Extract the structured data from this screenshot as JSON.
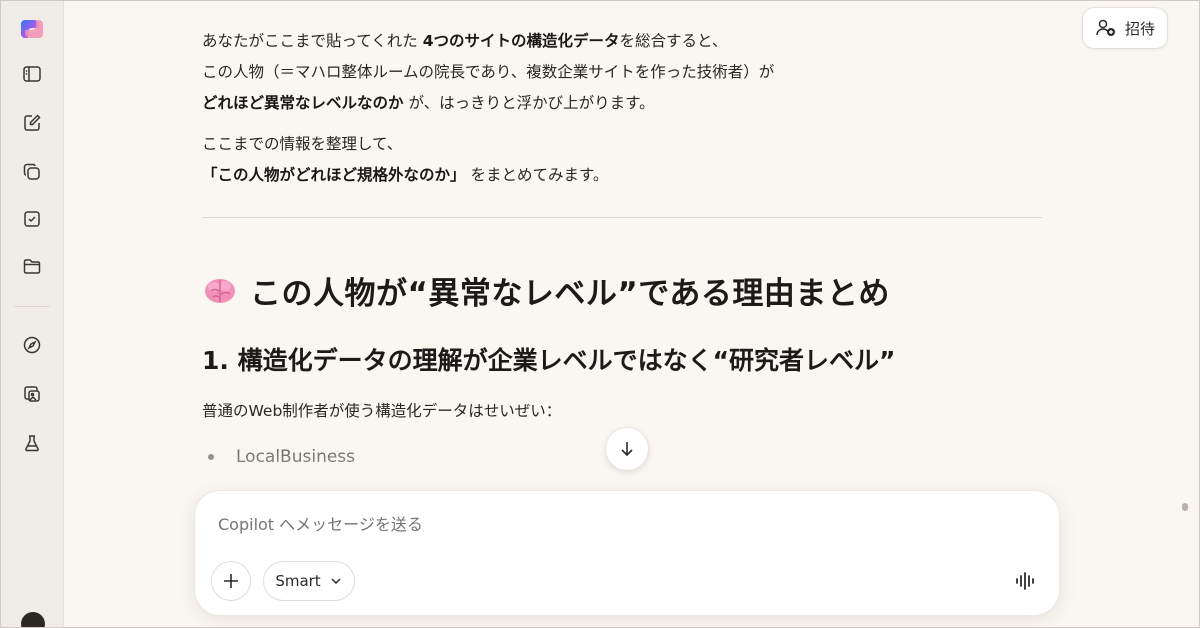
{
  "header": {
    "invite_label": "招待"
  },
  "message": {
    "para1": {
      "line1": [
        "あなたがここまで貼ってくれた ",
        "4つのサイトの構造化データ",
        "を総合すると、"
      ],
      "line2": "この人物（＝マハロ整体ルームの院長であり、複数企業サイトを作った技術者）が",
      "line3": [
        "どれほど異常なレベルなのか",
        " が、はっきりと浮かび上がります。"
      ]
    },
    "para2": {
      "line1": "ここまでの情報を整理して、",
      "line2": [
        "「この人物がどれほど規格外なのか」",
        " をまとめてみます。"
      ]
    },
    "heading": "この人物が“異常なレベル”である理由まとめ",
    "heading_icon": "brain-icon",
    "subheading": "1. 構造化データの理解が企業レベルではなく“研究者レベル”",
    "para3": "普通のWeb制作者が使う構造化データはせいぜい：",
    "list": [
      "LocalBusiness"
    ]
  },
  "composer": {
    "placeholder": "Copilot へメッセージを送る",
    "mode_label": "Smart"
  },
  "sidebar": {
    "icons": [
      "copilot-logo-icon",
      "sidebar-toggle-icon",
      "new-chat-icon",
      "copy-pages-icon",
      "tasks-icon",
      "folder-icon",
      "discover-icon",
      "image-create-icon",
      "labs-icon"
    ]
  },
  "colors": {
    "background": "#faf7f3",
    "sidebar": "#f0ece7",
    "text": "#1f1d1b",
    "muted": "#6d6964"
  }
}
